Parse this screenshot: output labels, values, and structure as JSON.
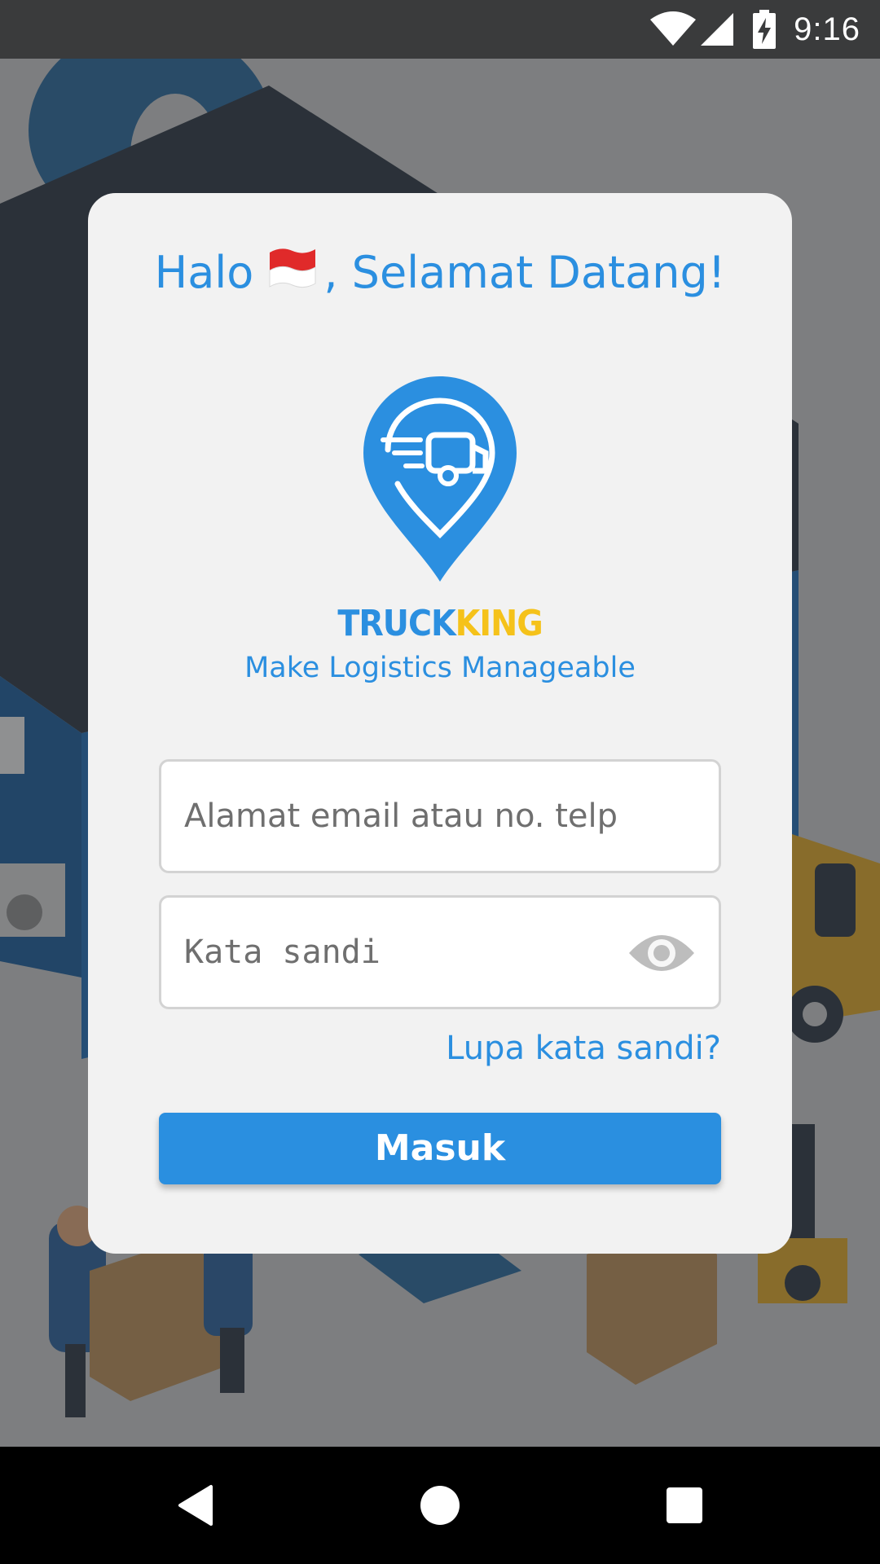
{
  "status_bar": {
    "time": "9:16",
    "icons": [
      "wifi-icon",
      "cell-signal-icon",
      "battery-charging-icon"
    ]
  },
  "login": {
    "greeting_prefix": "Halo",
    "greeting_suffix": ", Selamat Datang!",
    "flag_icon": "indonesia-flag-icon",
    "brand_part1": "TRUCK",
    "brand_part2": "KING",
    "tagline": "Make Logistics Manageable",
    "email_placeholder": "Alamat email atau no. telp",
    "password_placeholder": "Kata sandi",
    "forgot_label": "Lupa kata sandi?",
    "login_label": "Masuk"
  },
  "nav_bar": {
    "icons": [
      "back-icon",
      "home-icon",
      "recents-icon"
    ]
  },
  "colors": {
    "brand_blue": "#2b8fe0",
    "brand_yellow": "#f5c21a",
    "card_bg": "#f2f2f2"
  }
}
